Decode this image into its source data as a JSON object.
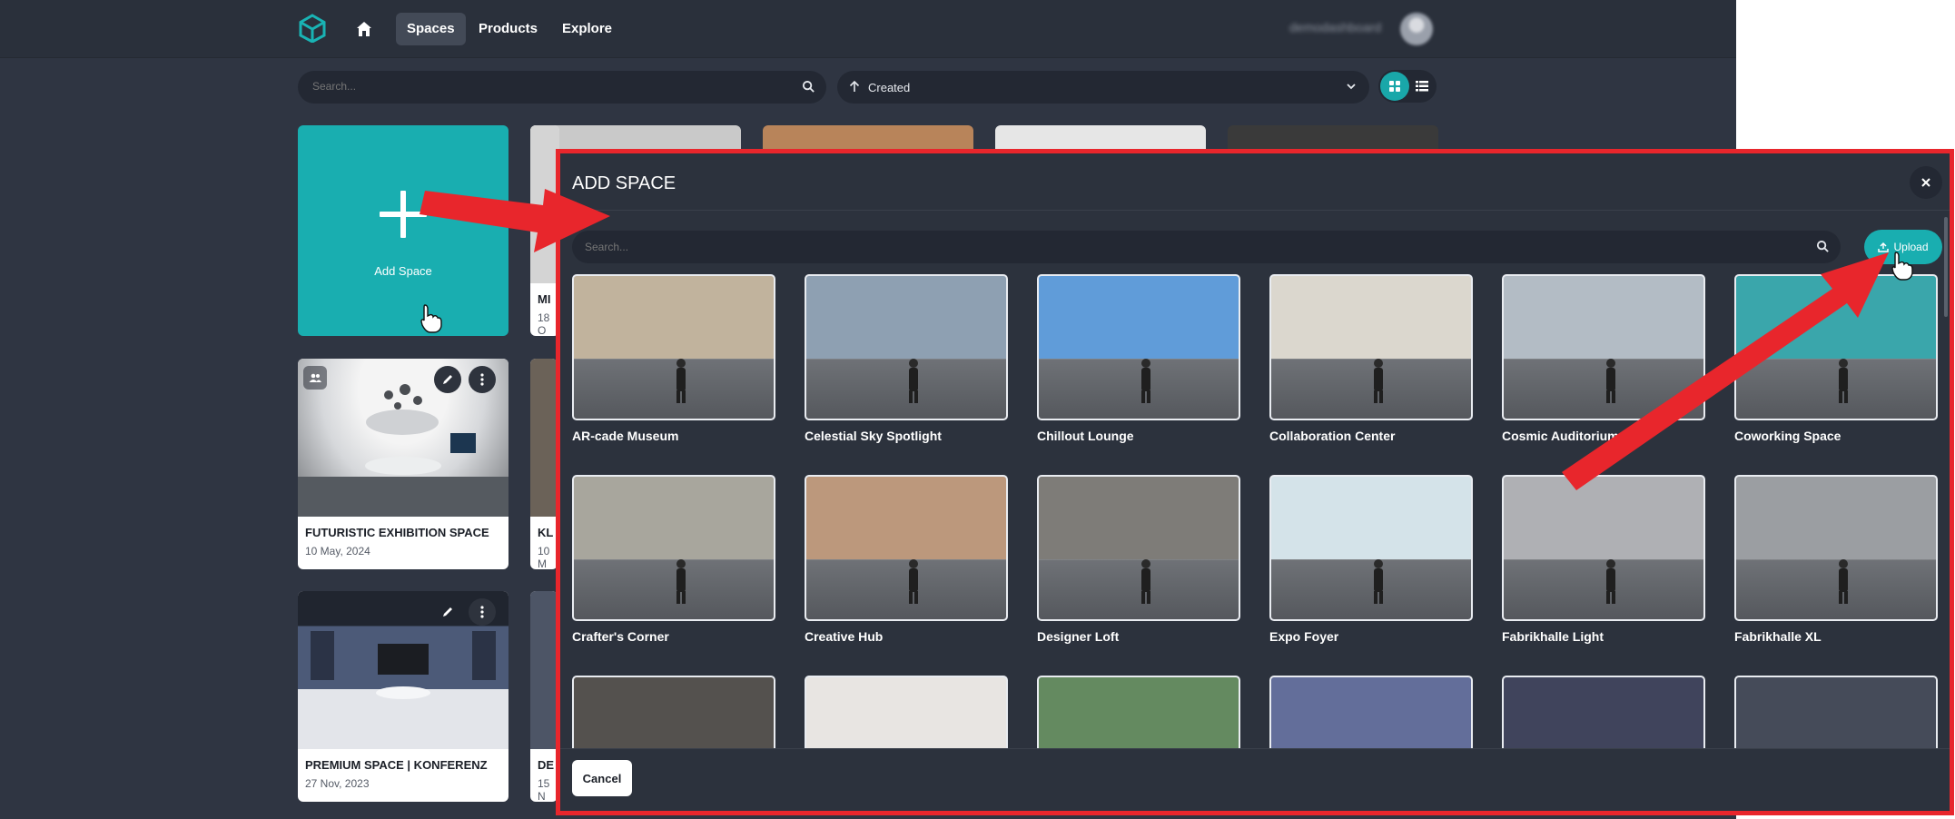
{
  "nav": {
    "logo_icon": "hexagon-logo-icon",
    "home_icon": "home-icon",
    "links": [
      {
        "label": "Spaces",
        "active": true
      },
      {
        "label": "Products",
        "active": false
      },
      {
        "label": "Explore",
        "active": false
      }
    ],
    "user_name": "demodashboard"
  },
  "toolbar": {
    "search_placeholder": "Search...",
    "sort_label": "Created",
    "view_modes": [
      "grid-view-icon",
      "list-view-icon"
    ]
  },
  "spaces": {
    "add_label": "Add Space",
    "cards": [
      {
        "title": "FUTURISTIC EXHIBITION SPACE",
        "date": "10 May, 2024"
      },
      {
        "title": "PREMIUM SPACE | KONFERENZ",
        "date": "27 Nov, 2023"
      },
      {
        "title": "MI",
        "date": "18 O"
      },
      {
        "title": "KL",
        "date": "10 M"
      },
      {
        "title": "DE",
        "date": "15 N"
      }
    ]
  },
  "modal": {
    "title": "ADD SPACE",
    "search_placeholder": "Search...",
    "upload_label": "Upload",
    "cancel_label": "Cancel",
    "templates": [
      {
        "name": "AR-cade Museum",
        "hue": "#b9a990"
      },
      {
        "name": "Celestial Sky Spotlight",
        "hue": "#7f93a8"
      },
      {
        "name": "Chillout Lounge",
        "hue": "#4b8fd4"
      },
      {
        "name": "Collaboration Center",
        "hue": "#d6d2c8"
      },
      {
        "name": "Cosmic Auditorium",
        "hue": "#a9b3bd"
      },
      {
        "name": "Coworking Space",
        "hue": "#1f9aa0"
      },
      {
        "name": "Crafter's Corner",
        "hue": "#9c9a90"
      },
      {
        "name": "Creative Hub",
        "hue": "#b38a6a"
      },
      {
        "name": "Designer Loft",
        "hue": "#6d6a66"
      },
      {
        "name": "Expo Foyer",
        "hue": "#cfe0e6"
      },
      {
        "name": "Fabrikhalle Light",
        "hue": "#a4a6aa"
      },
      {
        "name": "Fabrikhalle XL",
        "hue": "#8e9196"
      },
      {
        "name": "",
        "hue": "#3d3a36"
      },
      {
        "name": "",
        "hue": "#e5e2de"
      },
      {
        "name": "",
        "hue": "#4f7a4a"
      },
      {
        "name": "",
        "hue": "#4e5a8c"
      },
      {
        "name": "",
        "hue": "#262b46"
      },
      {
        "name": "",
        "hue": "#2c3342"
      }
    ]
  },
  "colors": {
    "accent": "#19aeb0",
    "background": "#2f3542",
    "annotation": "#e8262c"
  }
}
